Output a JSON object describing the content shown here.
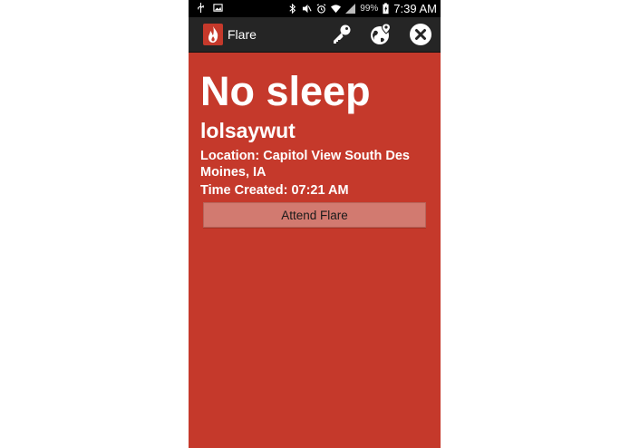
{
  "status_bar": {
    "battery_percent": "99%",
    "time": "7:39 AM",
    "icons": [
      "usb-icon",
      "image-icon",
      "bluetooth-icon",
      "mute-icon",
      "alarm-icon",
      "wifi-icon",
      "signal-icon",
      "battery-charging-icon"
    ]
  },
  "action_bar": {
    "app_title": "Flare",
    "app_icon": "flame-icon",
    "actions": [
      "key-icon",
      "globe-location-icon",
      "close-icon"
    ],
    "background": "#252525"
  },
  "flare": {
    "title": "No sleep",
    "user": "lolsaywut",
    "location": "Location: Capitol View South Des Moines, IA",
    "time_created": "Time Created: 07:21 AM",
    "attend_label": "Attend Flare",
    "background": "#c5392b"
  }
}
